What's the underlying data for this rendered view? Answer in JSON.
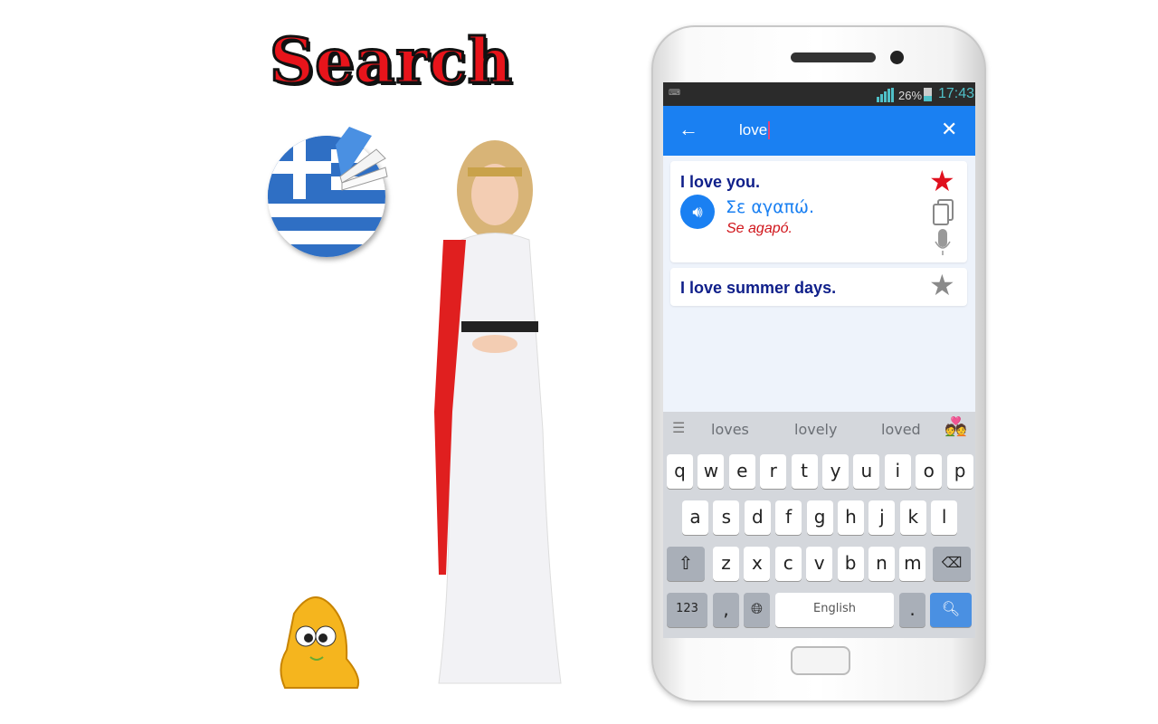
{
  "promo": {
    "title": "Search"
  },
  "status_bar": {
    "battery": "26%",
    "time": "17:43"
  },
  "app_bar": {
    "search_value": "love",
    "back_icon": "arrow-left-icon",
    "clear_icon": "close-icon"
  },
  "results": [
    {
      "phrase": "I love you.",
      "translation": "Σε αγαπώ.",
      "transliteration": "Se agapó.",
      "favorite": true
    },
    {
      "phrase": "I love summer days.",
      "favorite": false
    }
  ],
  "colors": {
    "accent": "#1a80f2",
    "favorite": "#e0101e",
    "phrase": "#0f1f8a",
    "translation": "#1a80f2",
    "transliteration": "#d0141a"
  },
  "keyboard": {
    "suggestions": [
      "loves",
      "lovely",
      "loved"
    ],
    "row1": [
      "q",
      "w",
      "e",
      "r",
      "t",
      "y",
      "u",
      "i",
      "o",
      "p"
    ],
    "row2": [
      "a",
      "s",
      "d",
      "f",
      "g",
      "h",
      "j",
      "k",
      "l"
    ],
    "row3": [
      "z",
      "x",
      "c",
      "v",
      "b",
      "n",
      "m"
    ],
    "numbers_key": "123",
    "comma": ",",
    "space_label": "English",
    "period": "."
  }
}
